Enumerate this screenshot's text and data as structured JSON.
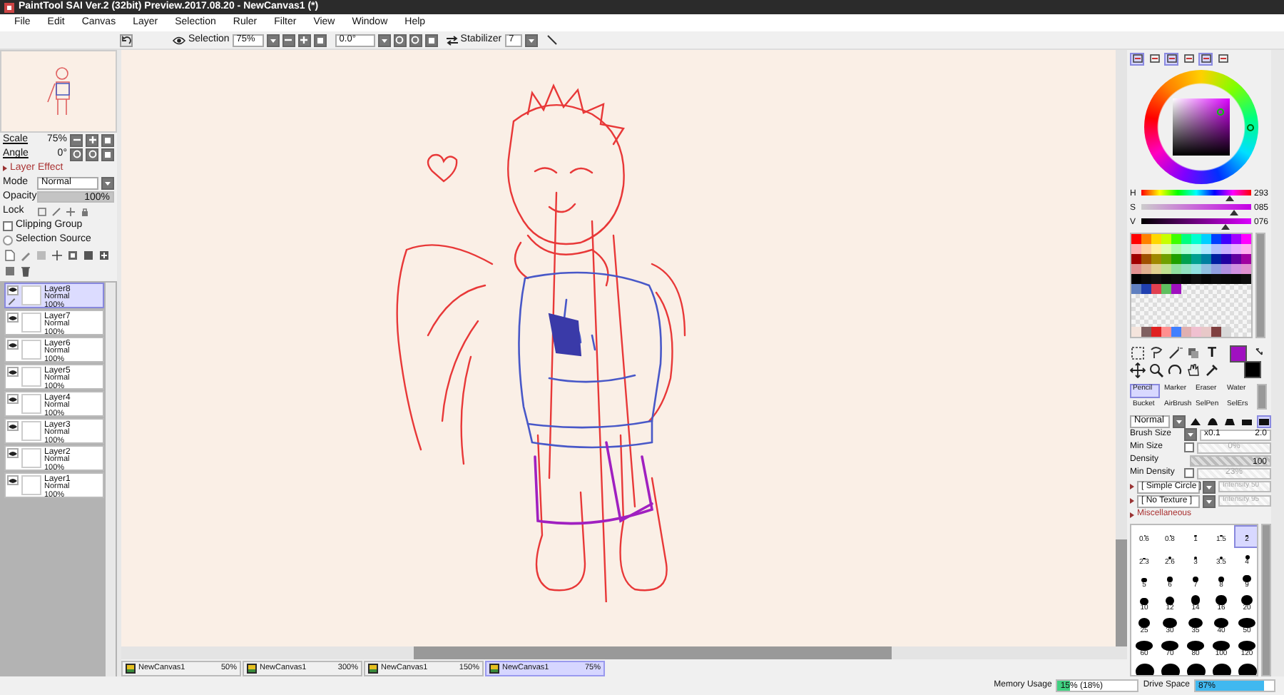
{
  "window": {
    "title": "PaintTool SAI Ver.2 (32bit) Preview.2017.08.20 - NewCanvas1 (*)"
  },
  "menu": [
    "File",
    "Edit",
    "Canvas",
    "Layer",
    "Selection",
    "Ruler",
    "Filter",
    "View",
    "Window",
    "Help"
  ],
  "toolbar": {
    "selection_label": "Selection",
    "zoom": "75%",
    "angle": "0.0°",
    "stabilizer_label": "Stabilizer",
    "stabilizer": "7"
  },
  "navigator": {
    "scale_label": "Scale",
    "scale": "75%",
    "angle_label": "Angle",
    "angle": "0°"
  },
  "layer_effect": {
    "title": "Layer Effect",
    "expanded": false,
    "mode_label": "Mode",
    "mode": "Normal",
    "opacity_label": "Opacity",
    "opacity": "100%",
    "level": 1,
    "lock_label": "Lock",
    "options": [
      {
        "label": "Clipping Group",
        "kind": "check",
        "checked": false
      },
      {
        "label": "Selection Source",
        "kind": "radio",
        "checked": false
      }
    ]
  },
  "layers": [
    {
      "name": "Layer8",
      "mode": "Normal",
      "opacity": "100%",
      "visible": true,
      "selected": true
    },
    {
      "name": "Layer7",
      "mode": "Normal",
      "opacity": "100%",
      "visible": true,
      "selected": false
    },
    {
      "name": "Layer6",
      "mode": "Normal",
      "opacity": "100%",
      "visible": true,
      "selected": false
    },
    {
      "name": "Layer5",
      "mode": "Normal",
      "opacity": "100%",
      "visible": true,
      "selected": false
    },
    {
      "name": "Layer4",
      "mode": "Normal",
      "opacity": "100%",
      "visible": true,
      "selected": false
    },
    {
      "name": "Layer3",
      "mode": "Normal",
      "opacity": "100%",
      "visible": true,
      "selected": false
    },
    {
      "name": "Layer2",
      "mode": "Normal",
      "opacity": "100%",
      "visible": true,
      "selected": false
    },
    {
      "name": "Layer1",
      "mode": "Normal",
      "opacity": "100%",
      "visible": true,
      "selected": false
    }
  ],
  "tabs": [
    {
      "label": "NewCanvas1",
      "zoom": "50%",
      "selected": false
    },
    {
      "label": "NewCanvas1",
      "zoom": "300%",
      "selected": false
    },
    {
      "label": "NewCanvas1",
      "zoom": "150%",
      "selected": false
    },
    {
      "label": "NewCanvas1",
      "zoom": "75%",
      "selected": true
    }
  ],
  "color_panel_buttons": [
    {
      "on": true
    },
    {
      "on": false
    },
    {
      "on": true
    },
    {
      "on": false
    },
    {
      "on": true
    },
    {
      "on": false
    }
  ],
  "hsv": [
    {
      "label": "H",
      "value": "293",
      "level": 0.81
    },
    {
      "label": "S",
      "value": "085",
      "level": 0.85
    },
    {
      "label": "V",
      "value": "076",
      "level": 0.76
    }
  ],
  "swatches": [
    {
      "color": "#ff0000"
    },
    {
      "color": "#ff8000"
    },
    {
      "color": "#ffd700"
    },
    {
      "color": "#c8ff00"
    },
    {
      "color": "#40ff00"
    },
    {
      "color": "#00ff80"
    },
    {
      "color": "#00ffd0"
    },
    {
      "color": "#00d0ff"
    },
    {
      "color": "#0040ff"
    },
    {
      "color": "#4000ff"
    },
    {
      "color": "#a000ff"
    },
    {
      "color": "#ff00ff"
    },
    {
      "color": "#ffb0b0"
    },
    {
      "color": "#ffd0a0"
    },
    {
      "color": "#fff0a0"
    },
    {
      "color": "#e0ffb0"
    },
    {
      "color": "#b0ffb0"
    },
    {
      "color": "#b0ffd8"
    },
    {
      "color": "#b0fff0"
    },
    {
      "color": "#b0e8ff"
    },
    {
      "color": "#b0c0ff"
    },
    {
      "color": "#c8b0ff"
    },
    {
      "color": "#e8b0ff"
    },
    {
      "color": "#ffb0f0"
    },
    {
      "color": "#a00000"
    },
    {
      "color": "#a05000"
    },
    {
      "color": "#a08800"
    },
    {
      "color": "#70a000"
    },
    {
      "color": "#20a000"
    },
    {
      "color": "#00a050"
    },
    {
      "color": "#00a090"
    },
    {
      "color": "#0080a0"
    },
    {
      "color": "#0020a0"
    },
    {
      "color": "#2000a0"
    },
    {
      "color": "#6000a0"
    },
    {
      "color": "#a000a0"
    },
    {
      "color": "#e09090"
    },
    {
      "color": "#e0b090"
    },
    {
      "color": "#e0d090"
    },
    {
      "color": "#c0e090"
    },
    {
      "color": "#90e0a0"
    },
    {
      "color": "#90e0c0"
    },
    {
      "color": "#90e0e0"
    },
    {
      "color": "#90c0e0"
    },
    {
      "color": "#90a0e0"
    },
    {
      "color": "#b090e0"
    },
    {
      "color": "#d090e0"
    },
    {
      "color": "#e090d0"
    },
    {
      "color": "#000000"
    },
    {
      "color": "#0a0a0a"
    },
    {
      "color": "#101010"
    },
    {
      "color": "#080808"
    },
    {
      "color": "#0c0c0c"
    },
    {
      "color": "#050505"
    },
    {
      "color": "#0e0e0e"
    },
    {
      "color": "#060606"
    },
    {
      "color": "#0b0b0b"
    },
    {
      "color": "#090909"
    },
    {
      "color": "#070707"
    },
    {
      "color": "#0d0d0d"
    },
    {
      "color": "#6080c0"
    },
    {
      "color": "#2040b0"
    },
    {
      "color": "#e04050"
    },
    {
      "color": "#60c060"
    },
    {
      "color": "#a010c0"
    }
  ],
  "recent_swatches": [
    {
      "color": "#f4e4dc"
    },
    {
      "color": "#806060"
    },
    {
      "color": "#e02020"
    },
    {
      "color": "#ff9090"
    },
    {
      "color": "#4080ff"
    },
    {
      "color": "#e0b0b0"
    },
    {
      "color": "#f0c0d0"
    },
    {
      "color": "#e8c8c8"
    },
    {
      "color": "#804040"
    },
    {
      "color": "#d8d8d8"
    }
  ],
  "text_tool": "T",
  "current_colors": [
    {
      "kind": "foreground",
      "color": "#a010c0"
    },
    {
      "kind": "background",
      "color": "#000000"
    }
  ],
  "brushes": [
    {
      "label": "Pencil",
      "selected": true
    },
    {
      "label": "Marker",
      "selected": false
    },
    {
      "label": "Eraser",
      "selected": false
    },
    {
      "label": "Water",
      "selected": false
    },
    {
      "label": "Bucket",
      "selected": false
    },
    {
      "label": "AirBrush",
      "selected": false
    },
    {
      "label": "SelPen",
      "selected": false
    },
    {
      "label": "SelErs",
      "selected": false
    }
  ],
  "brush_mode": "Normal",
  "brush_shapes": [
    {
      "selected": false
    },
    {
      "selected": false
    },
    {
      "selected": false
    },
    {
      "selected": false
    },
    {
      "selected": true
    }
  ],
  "brush_rows": [
    {
      "kind": "field",
      "label": "Brush Size",
      "prefix": "x0.1",
      "value": "2.0"
    },
    {
      "kind": "check",
      "label": "Min Size",
      "checked": false,
      "value": "0%",
      "disabled": true
    },
    {
      "kind": "slider",
      "label": "Density",
      "value": "100",
      "level": 1
    },
    {
      "kind": "check",
      "label": "Min Density",
      "checked": false,
      "value": "23%",
      "disabled": true
    }
  ],
  "brush_options": [
    {
      "label": "[ Simple Circle ]",
      "expanded": false,
      "intensity": "Intensity 50",
      "intensity_disabled": true
    },
    {
      "label": "[ No Texture ]",
      "expanded": false,
      "intensity": "Intensity 95",
      "intensity_disabled": true
    }
  ],
  "misc": {
    "label": "Miscellaneous",
    "expanded": false
  },
  "brush_sizes": [
    {
      "label": "0.6",
      "selected": false
    },
    {
      "label": "0.8",
      "selected": false
    },
    {
      "label": "1",
      "selected": false
    },
    {
      "label": "1.5",
      "selected": false
    },
    {
      "label": "2",
      "selected": true
    },
    {
      "label": "2.3",
      "selected": false
    },
    {
      "label": "2.6",
      "selected": false
    },
    {
      "label": "3",
      "selected": false
    },
    {
      "label": "3.5",
      "selected": false
    },
    {
      "label": "4",
      "selected": false
    },
    {
      "label": "5",
      "selected": false
    },
    {
      "label": "6",
      "selected": false
    },
    {
      "label": "7",
      "selected": false
    },
    {
      "label": "8",
      "selected": false
    },
    {
      "label": "9",
      "selected": false
    },
    {
      "label": "10",
      "selected": false
    },
    {
      "label": "12",
      "selected": false
    },
    {
      "label": "14",
      "selected": false
    },
    {
      "label": "16",
      "selected": false
    },
    {
      "label": "20",
      "selected": false
    },
    {
      "label": "25",
      "selected": false
    },
    {
      "label": "30",
      "selected": false
    },
    {
      "label": "35",
      "selected": false
    },
    {
      "label": "40",
      "selected": false
    },
    {
      "label": "50",
      "selected": false
    },
    {
      "label": "60",
      "selected": false
    },
    {
      "label": "70",
      "selected": false
    },
    {
      "label": "80",
      "selected": false
    },
    {
      "label": "100",
      "selected": false
    },
    {
      "label": "120",
      "selected": false
    }
  ],
  "status": {
    "memory_label": "Memory Usage",
    "memory": "15% (18%)",
    "memory_level": {
      "level": 0.15
    },
    "drive_label": "Drive Space",
    "drive": "87%",
    "drive_level": {
      "level": 0.87
    }
  }
}
